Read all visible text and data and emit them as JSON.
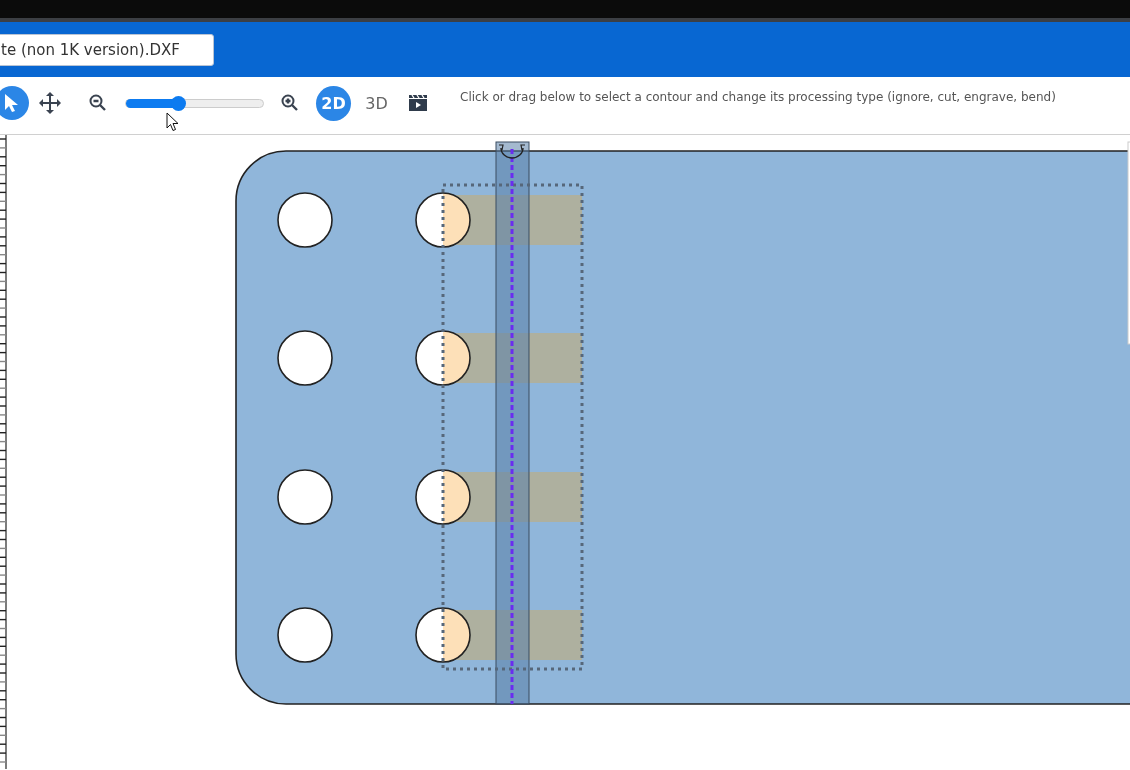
{
  "header": {
    "file_name": "te (non 1K version).DXF"
  },
  "toolbar": {
    "tools": [
      {
        "kind": "select",
        "selected": true
      },
      {
        "kind": "pan",
        "selected": false
      }
    ],
    "zoom_slider": {
      "level": 0.39
    },
    "views": [
      {
        "label": "2D",
        "selected": true
      },
      {
        "label": "3D",
        "selected": false
      }
    ],
    "hint": "Click or drag below to select a contour and change its processing type (ignore, cut, engrave, bend)"
  }
}
